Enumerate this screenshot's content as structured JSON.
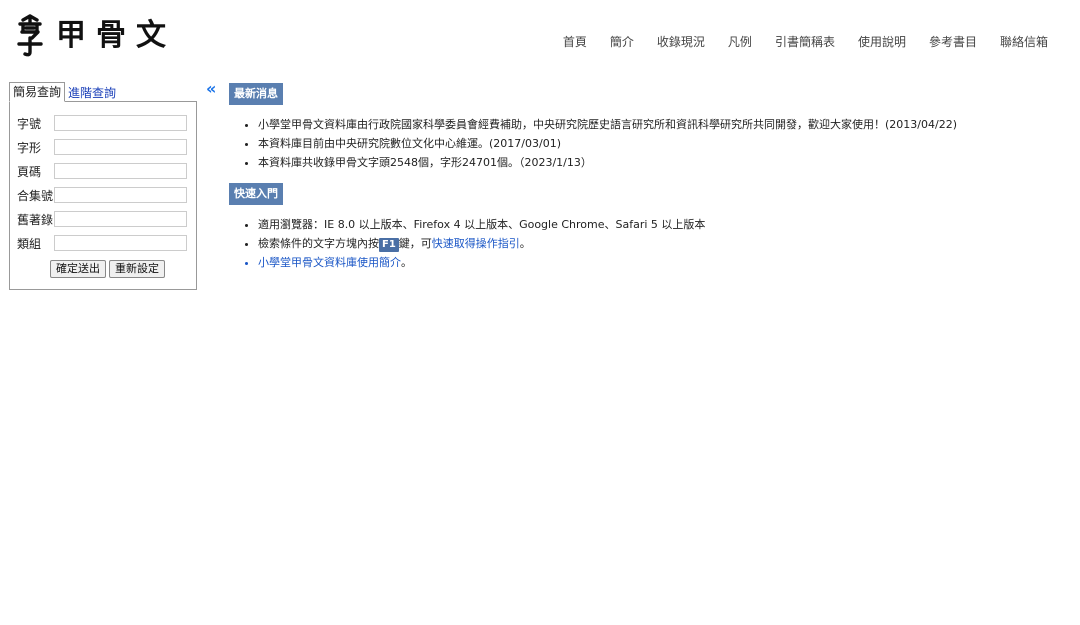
{
  "header": {
    "logo_title": "甲骨文"
  },
  "nav": {
    "items": [
      {
        "label": "首頁"
      },
      {
        "label": "簡介"
      },
      {
        "label": "收錄現況"
      },
      {
        "label": "凡例"
      },
      {
        "label": "引書簡稱表"
      },
      {
        "label": "使用說明"
      },
      {
        "label": "參考書目"
      },
      {
        "label": "聯絡信箱"
      }
    ]
  },
  "search": {
    "tabs": [
      {
        "label": "簡易查詢",
        "active": true
      },
      {
        "label": "進階查詢",
        "active": false
      }
    ],
    "collapse_icon": "double-chevron-left-icon",
    "fields": [
      {
        "label": "字號",
        "value": ""
      },
      {
        "label": "字形",
        "value": ""
      },
      {
        "label": "頁碼",
        "value": ""
      },
      {
        "label": "合集號",
        "value": ""
      },
      {
        "label": "舊著錄",
        "value": ""
      },
      {
        "label": "類組",
        "value": ""
      }
    ],
    "submit_label": "確定送出",
    "reset_label": "重新設定"
  },
  "news": {
    "title": "最新消息",
    "items": [
      "小學堂甲骨文資料庫由行政院國家科學委員會經費補助，中央研究院歷史語言研究所和資訊科學研究所共同開發，歡迎大家使用！(2013/04/22)",
      "本資料庫目前由中央研究院數位文化中心維運。(2017/03/01)",
      "本資料庫共收錄甲骨文字頭2548個，字形24701個。（2023/1/13）"
    ]
  },
  "quickstart": {
    "title": "快速入門",
    "browsers": "適用瀏覽器：IE 8.0 以上版本、Firefox 4 以上版本、Google Chrome、Safari 5 以上版本",
    "help_prefix": "檢索條件的文字方塊內按",
    "help_key": "F1",
    "help_middle": "鍵，可",
    "help_link": "快速取得操作指引",
    "help_suffix": "。",
    "intro_link": "小學堂甲骨文資料庫使用簡介",
    "intro_suffix": "。"
  },
  "colors": {
    "section_title_bg": "#5a7fb0",
    "link": "#1a56c6",
    "tab_link": "#1a3fb8"
  }
}
